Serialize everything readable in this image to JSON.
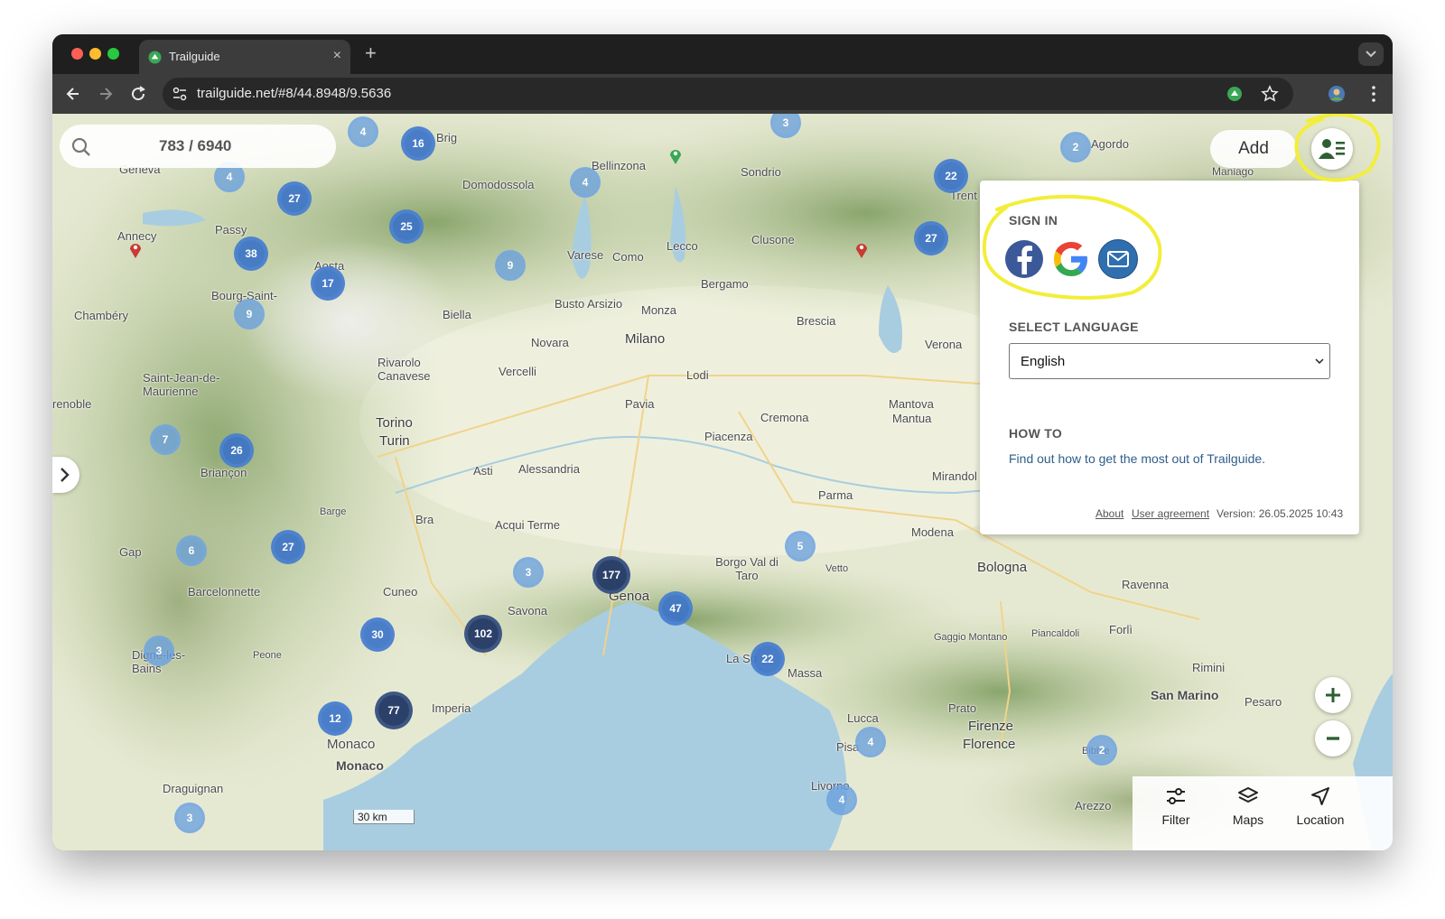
{
  "browser": {
    "tab_title": "Trailguide",
    "url": "trailguide.net/#8/44.8948/9.5636",
    "new_tab_label": "+",
    "tab_close_label": "×"
  },
  "map": {
    "search_count": "783 / 6940",
    "add_label": "Add",
    "scale_label": "30 km",
    "places": [
      "Geneva",
      "Annecy",
      "Chambéry",
      "Passy",
      "Aosta",
      "Bourg-Saint-",
      "Saint-Jean-de-Maurienne",
      "renoble",
      "Briançon",
      "Barcelonnette",
      "Gap",
      "Digne-les-Bains",
      "Draguignan",
      "Monaco",
      "Monaco",
      "Imperia",
      "Cuneo",
      "Savona",
      "Genoa",
      "Torino",
      "Turin",
      "Asti",
      "Alessandria",
      "Acqui Terme",
      "Bra",
      "Biella",
      "Novara",
      "Vercelli",
      "Rivarolo Canavese",
      "Milano",
      "Monza",
      "Busto Arsizio",
      "Varese",
      "Como",
      "Lecco",
      "Bergamo",
      "Brescia",
      "Verona",
      "Lodi",
      "Pavia",
      "Cremona",
      "Piacenza",
      "Mantova",
      "Mantua",
      "Parma",
      "Modena",
      "Bologna",
      "Ravenna",
      "Forlì",
      "Rimini",
      "San Marino",
      "Pesaro",
      "Firenze",
      "Florence",
      "Prato",
      "Lucca",
      "Pisa",
      "Livorno",
      "Massa",
      "La Sp",
      "Arezzo",
      "Domodossola",
      "Bellinzona",
      "Sondrio",
      "Clusone",
      "Trent",
      "Agordo",
      "Borgo Val di Taro",
      "Vetto",
      "Mirandol",
      "Gaggio Montano",
      "Piancaldoli",
      "Bibbie",
      "Barge",
      "Peone",
      "Brig",
      "Maniago"
    ],
    "clusters": [
      {
        "n": "16"
      },
      {
        "n": "4"
      },
      {
        "n": "27"
      },
      {
        "n": "25"
      },
      {
        "n": "38"
      },
      {
        "n": "17"
      },
      {
        "n": "9"
      },
      {
        "n": "4"
      },
      {
        "n": "9"
      },
      {
        "n": "3"
      },
      {
        "n": "22"
      },
      {
        "n": "27"
      },
      {
        "n": "2"
      },
      {
        "n": "7"
      },
      {
        "n": "26"
      },
      {
        "n": "27"
      },
      {
        "n": "6"
      },
      {
        "n": "3"
      },
      {
        "n": "177"
      },
      {
        "n": "47"
      },
      {
        "n": "5"
      },
      {
        "n": "102"
      },
      {
        "n": "30"
      },
      {
        "n": "3"
      },
      {
        "n": "22"
      },
      {
        "n": "77"
      },
      {
        "n": "12"
      },
      {
        "n": "4"
      },
      {
        "n": "2"
      },
      {
        "n": "4"
      },
      {
        "n": "3"
      },
      {
        "n": "4"
      }
    ]
  },
  "panel": {
    "sign_in_heading": "SIGN IN",
    "language_heading": "SELECT LANGUAGE",
    "language_value": "English",
    "howto_heading": "HOW TO",
    "howto_link": "Find out how to get the most out of Trailguide.",
    "about_link": "About",
    "agreement_link": "User agreement",
    "version": "Version: 26.05.2025 10:43"
  },
  "controls": {
    "zoom_in": "+",
    "zoom_out": "−",
    "filter_label": "Filter",
    "maps_label": "Maps",
    "location_label": "Location"
  },
  "colors": {
    "annotation": "#f2ee3a",
    "facebook": "#3b5998",
    "email": "#2f6fb0",
    "cluster_dark": "#22385e",
    "sea": "#a8cde0"
  }
}
